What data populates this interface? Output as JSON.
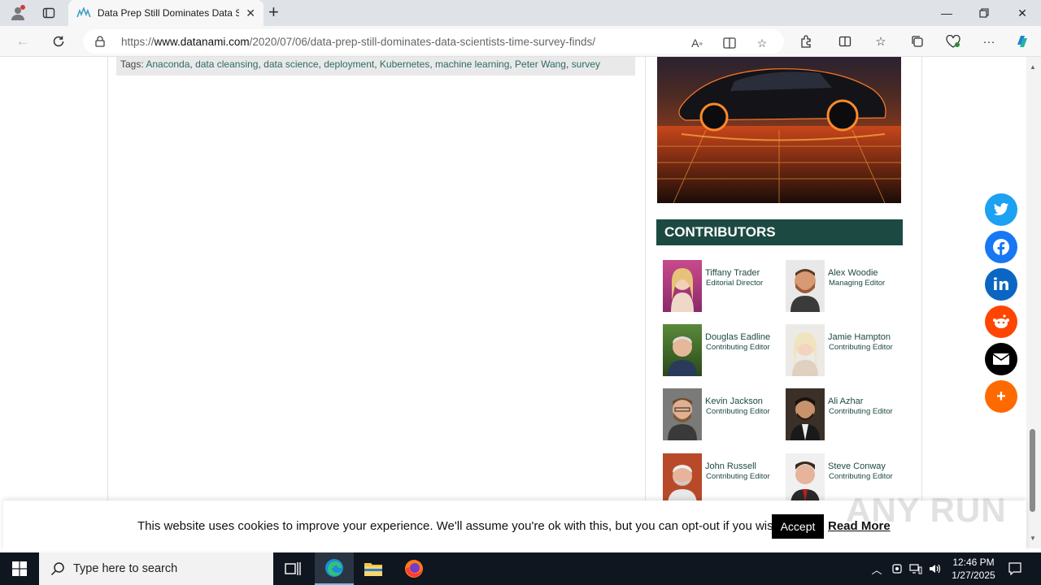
{
  "browser": {
    "tab_title": "Data Prep Still Dominates Data Sc",
    "url_prefix": "https://",
    "url_domain": "www.datanami.com",
    "url_path": "/2020/07/06/data-prep-still-dominates-data-scientists-time-survey-finds/"
  },
  "article": {
    "tags_label": "Tags:",
    "tags": [
      "Anaconda",
      "data cleansing",
      "data science",
      "deployment",
      "Kubernetes",
      "machine learning",
      "Peter Wang",
      "survey"
    ]
  },
  "contributors": {
    "heading": "CONTRIBUTORS",
    "people": [
      {
        "name": "Tiffany Trader",
        "role": "Editorial Director"
      },
      {
        "name": "Alex Woodie",
        "role": "Managing Editor"
      },
      {
        "name": "Douglas Eadline",
        "role": "Contributing Editor"
      },
      {
        "name": "Jamie Hampton",
        "role": "Contributing Editor"
      },
      {
        "name": "Kevin Jackson",
        "role": "Contributing Editor"
      },
      {
        "name": "Ali Azhar",
        "role": "Contributing Editor"
      },
      {
        "name": "John Russell",
        "role": "Contributing Editor"
      },
      {
        "name": "Steve Conway",
        "role": "Contributing Editor"
      }
    ]
  },
  "share": {
    "buttons": [
      {
        "name": "twitter",
        "color": "#1da1f2"
      },
      {
        "name": "facebook",
        "color": "#1877f2"
      },
      {
        "name": "linkedin",
        "color": "#0a66c2"
      },
      {
        "name": "reddit",
        "color": "#ff4500"
      },
      {
        "name": "email",
        "color": "#000000"
      },
      {
        "name": "more",
        "color": "#ff6a00"
      }
    ]
  },
  "cookie": {
    "message": "This website uses cookies to improve your experience. We'll assume you're ok with this, but you can opt-out if you wish.",
    "accept_label": "Accept",
    "read_more_label": "Read More"
  },
  "watermark": "ANY RUN",
  "taskbar": {
    "search_placeholder": "Type here to search",
    "time": "12:46 PM",
    "date": "1/27/2025"
  }
}
